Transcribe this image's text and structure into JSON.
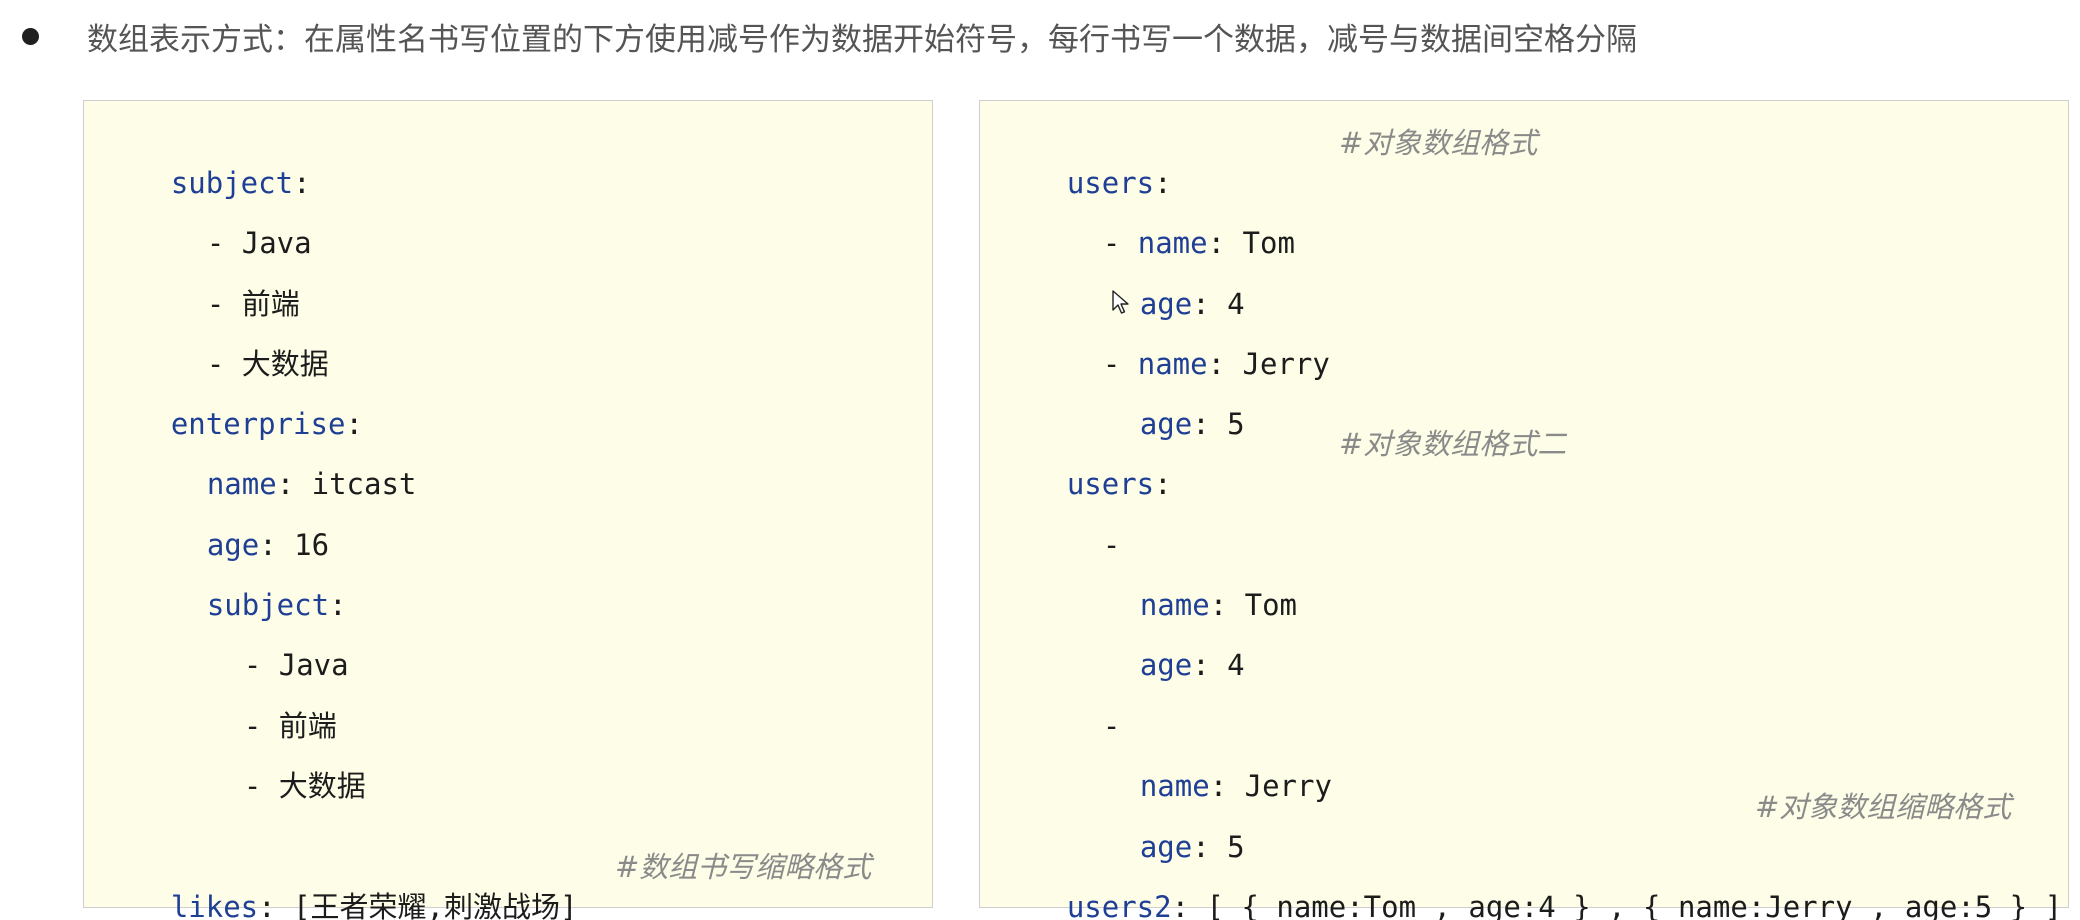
{
  "heading": {
    "text": "数组表示方式：在属性名书写位置的下方使用减号作为数据开始符号，每行书写一个数据，减号与数据间空格分隔"
  },
  "left_code": {
    "l1_key": "subject",
    "colon": ":",
    "l2": "- Java",
    "l3": "- 前端",
    "l4": "- 大数据",
    "l5_key": "enterprise",
    "l6_key": "name",
    "l6_val": " itcast",
    "l7_key": "age",
    "l7_val": " 16",
    "l8_key": "subject",
    "l9": "- Java",
    "l10": "- 前端",
    "l11": "- 大数据",
    "l12_key": "likes",
    "l12_val": " [王者荣耀,刺激战场]",
    "l12_comment": "#数组书写缩略格式"
  },
  "right_code": {
    "users_key": "users",
    "colon": ":",
    "comment1": "#对象数组格式",
    "dash": "- ",
    "dash_only": "-",
    "name_key": "name",
    "age_key": "age",
    "tom": " Tom",
    "jerry": " Jerry",
    "age4": " 4",
    "age5": " 5",
    "comment2": "#对象数组格式二",
    "comment3": "#对象数组缩略格式",
    "users2_key": "users2",
    "users2_val": " [ { name:Tom , age:4 } , { name:Jerry , age:5 } ]"
  },
  "icons": {
    "cursor": "mouse-pointer-icon"
  }
}
